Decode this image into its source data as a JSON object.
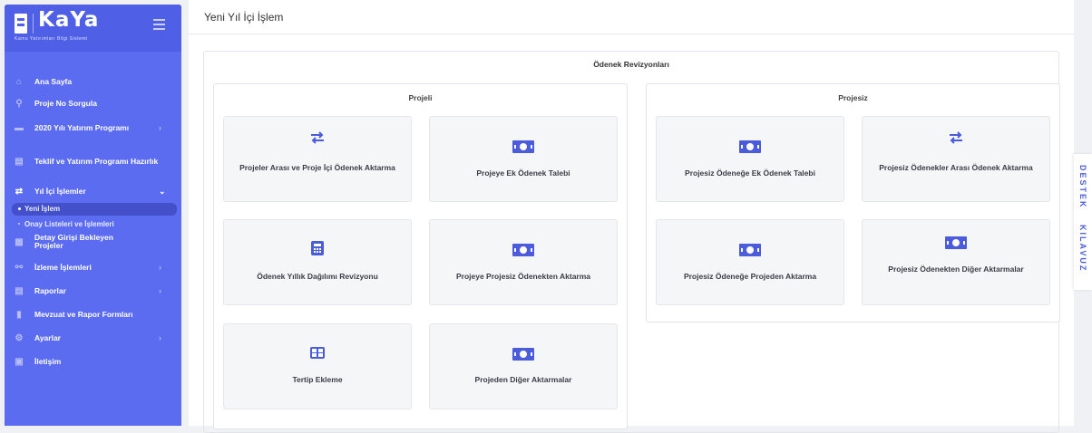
{
  "brand": {
    "name": "KaYa",
    "subtitle": "Kamu Yatırımları Bilgi Sistemi"
  },
  "sidebar": {
    "items": [
      {
        "label": "Ana Sayfa",
        "icon": "home-icon"
      },
      {
        "label": "Proje No Sorgula",
        "icon": "search-icon"
      },
      {
        "label": "2020 Yılı Yatırım Programı",
        "icon": "folder-icon"
      },
      {
        "label": "Teklif ve Yatırım Programı Hazırlık",
        "icon": "chart-icon"
      },
      {
        "label": "Yıl İçi İşlemler",
        "icon": "swap-icon"
      },
      {
        "label": "Detay Girişi Bekleyen Projeler",
        "icon": "list-icon"
      },
      {
        "label": "İzleme İşlemleri",
        "icon": "binoculars-icon"
      },
      {
        "label": "Raporlar",
        "icon": "chart-icon"
      },
      {
        "label": "Mevzuat ve Rapor Formları",
        "icon": "file-icon"
      },
      {
        "label": "Ayarlar",
        "icon": "gear-icon"
      },
      {
        "label": "İletişim",
        "icon": "contact-icon"
      }
    ],
    "subitems": [
      {
        "label": "Yeni İşlem"
      },
      {
        "label": "Onay Listeleri ve İşlemleri"
      }
    ]
  },
  "page": {
    "title": "Yeni Yıl İçi İşlem"
  },
  "section": {
    "title": "Ödenek Revizyonları"
  },
  "groups": {
    "projeli": {
      "title": "Projeli",
      "cards": [
        {
          "label": "Projeler Arası ve Proje İçi Ödenek Aktarma",
          "icon": "swap-icon"
        },
        {
          "label": "Projeye Ek Ödenek Talebi",
          "icon": "money-icon"
        },
        {
          "label": "Ödenek Yıllık Dağılımı Revizyonu",
          "icon": "calculator-icon"
        },
        {
          "label": "Projeye Projesiz Ödenekten Aktarma",
          "icon": "money-icon"
        },
        {
          "label": "Tertip Ekleme",
          "icon": "table-icon"
        },
        {
          "label": "Projeden Diğer Aktarmalar",
          "icon": "money-icon"
        }
      ]
    },
    "projesiz": {
      "title": "Projesiz",
      "cards": [
        {
          "label": "Projesiz Ödeneğe Ek Ödenek Talebi",
          "icon": "money-icon"
        },
        {
          "label": "Projesiz Ödenekler Arası Ödenek Aktarma",
          "icon": "swap-icon"
        },
        {
          "label": "Projesiz Ödeneğe Projeden Aktarma",
          "icon": "money-icon"
        },
        {
          "label": "Projesiz Ödenekten Diğer Aktarmalar",
          "icon": "money-icon"
        }
      ]
    }
  },
  "sidetab": {
    "destek": "DESTEK",
    "kilavuz": "KILAVUZ"
  },
  "colors": {
    "sidebar": "#5b6cf0",
    "accent": "#4a5bdc",
    "active_sub": "#4350c9"
  }
}
